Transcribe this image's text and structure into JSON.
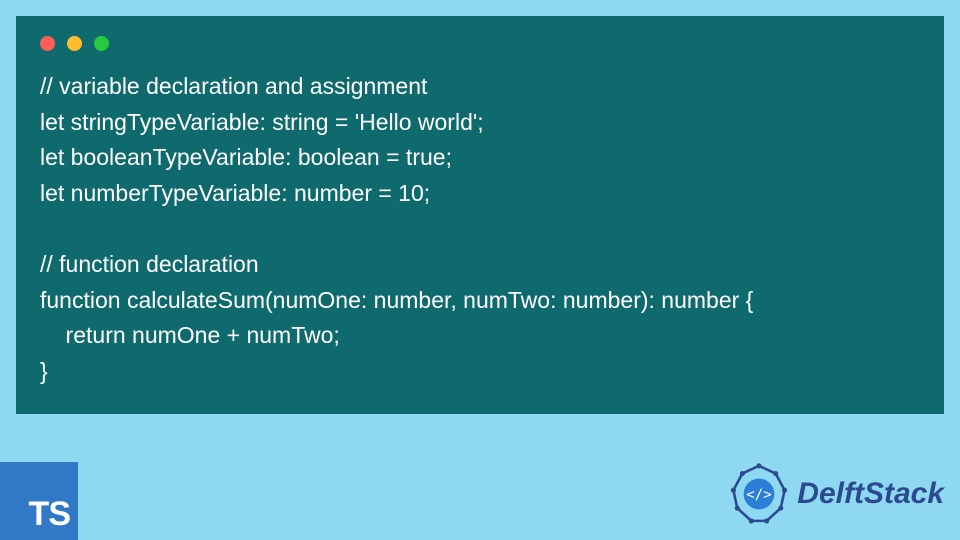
{
  "window": {
    "dots": [
      "red",
      "yellow",
      "green"
    ]
  },
  "code": {
    "lines": [
      "// variable declaration and assignment",
      "let stringTypeVariable: string = 'Hello world';",
      "let booleanTypeVariable: boolean = true;",
      "let numberTypeVariable: number = 10;",
      "",
      "// function declaration",
      "function calculateSum(numOne: number, numTwo: number): number {",
      "    return numOne + numTwo;",
      "}"
    ]
  },
  "badge": {
    "label": "TS"
  },
  "brand": {
    "name": "DelftStack"
  },
  "colors": {
    "bg": "#8fd8f2",
    "window": "#0f6a6e",
    "code_text": "#ffffff",
    "ts_bg": "#3178c6",
    "brand_text": "#2b4a8f"
  }
}
